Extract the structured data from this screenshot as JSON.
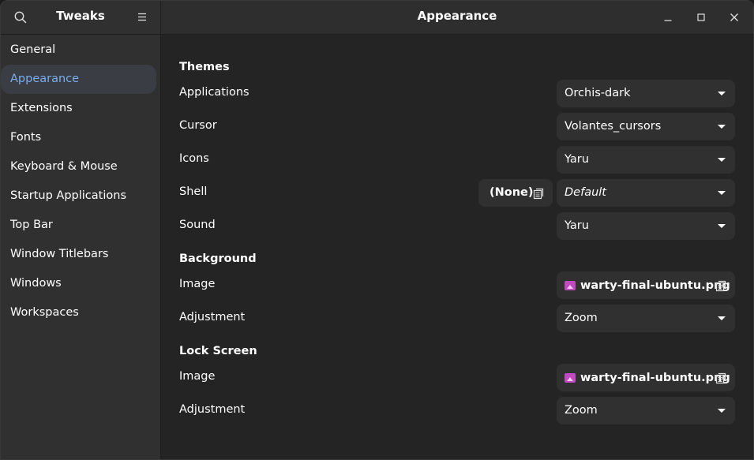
{
  "sidebar": {
    "title": "Tweaks",
    "items": [
      {
        "label": "General"
      },
      {
        "label": "Appearance",
        "active": true
      },
      {
        "label": "Extensions"
      },
      {
        "label": "Fonts"
      },
      {
        "label": "Keyboard & Mouse"
      },
      {
        "label": "Startup Applications"
      },
      {
        "label": "Top Bar"
      },
      {
        "label": "Window Titlebars"
      },
      {
        "label": "Windows"
      },
      {
        "label": "Workspaces"
      }
    ]
  },
  "main": {
    "title": "Appearance",
    "themes": {
      "heading": "Themes",
      "applications": {
        "label": "Applications",
        "value": "Orchis-dark"
      },
      "cursor": {
        "label": "Cursor",
        "value": "Volantes_cursors"
      },
      "icons": {
        "label": "Icons",
        "value": "Yaru"
      },
      "shell": {
        "label": "Shell",
        "file_label": "(None)",
        "value": "Default"
      },
      "sound": {
        "label": "Sound",
        "value": "Yaru"
      }
    },
    "background": {
      "heading": "Background",
      "image": {
        "label": "Image",
        "value": "warty-final-ubuntu.png"
      },
      "adjustment": {
        "label": "Adjustment",
        "value": "Zoom"
      }
    },
    "lock_screen": {
      "heading": "Lock Screen",
      "image": {
        "label": "Image",
        "value": "warty-final-ubuntu.png"
      },
      "adjustment": {
        "label": "Adjustment",
        "value": "Zoom"
      }
    }
  },
  "colors": {
    "accent": "#78aeed",
    "background": "#242424",
    "sidebar": "#303030"
  },
  "icons": [
    "search-icon",
    "hamburger-menu-icon",
    "minimize-icon",
    "maximize-icon",
    "close-icon",
    "document-open-icon",
    "image-file-icon",
    "chevron-down-icon"
  ]
}
